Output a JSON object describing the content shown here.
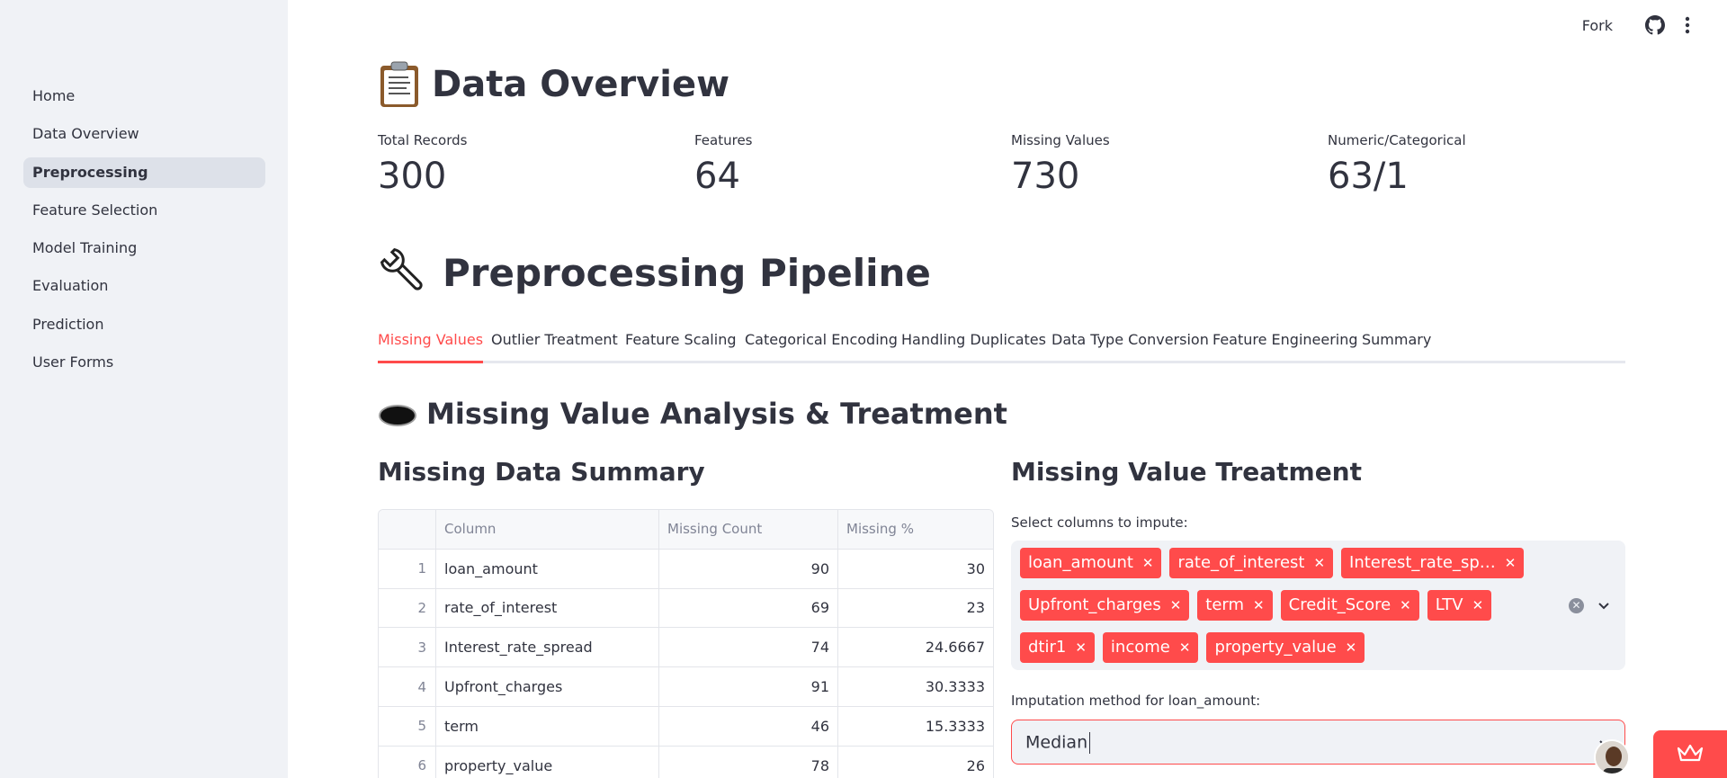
{
  "sidebar": {
    "items": [
      {
        "label": "Home"
      },
      {
        "label": "Data Overview"
      },
      {
        "label": "Preprocessing",
        "active": true
      },
      {
        "label": "Feature Selection"
      },
      {
        "label": "Model Training"
      },
      {
        "label": "Evaluation"
      },
      {
        "label": "Prediction"
      },
      {
        "label": "User Forms"
      }
    ]
  },
  "header": {
    "fork_label": "Fork",
    "github_icon": "github-icon",
    "menu_icon": "kebab-menu-icon"
  },
  "main": {
    "title": "Data Overview",
    "title_icon": "clipboard-icon",
    "metrics": [
      {
        "label": "Total Records",
        "value": "300"
      },
      {
        "label": "Features",
        "value": "64"
      },
      {
        "label": "Missing Values",
        "value": "730"
      },
      {
        "label": "Numeric/Categorical",
        "value": "63/1"
      }
    ],
    "pipeline_title": "Preprocessing Pipeline",
    "pipeline_icon": "wrench-icon",
    "tabs": [
      {
        "label": "Missing Values",
        "active": true
      },
      {
        "label": "Outlier Treatment"
      },
      {
        "label": "Feature Scaling"
      },
      {
        "label": "Categorical Encoding"
      },
      {
        "label": "Handling Duplicates"
      },
      {
        "label": "Data Type Conversion"
      },
      {
        "label": "Feature Engineering"
      },
      {
        "label": "Summary"
      }
    ],
    "section_title": "Missing Value Analysis & Treatment",
    "section_icon": "hole-icon",
    "summary": {
      "title": "Missing Data Summary",
      "columns": [
        "",
        "Column",
        "Missing Count",
        "Missing %"
      ],
      "rows": [
        {
          "idx": "1",
          "column": "loan_amount",
          "count": "90",
          "pct": "30"
        },
        {
          "idx": "2",
          "column": "rate_of_interest",
          "count": "69",
          "pct": "23"
        },
        {
          "idx": "3",
          "column": "Interest_rate_spread",
          "count": "74",
          "pct": "24.6667"
        },
        {
          "idx": "4",
          "column": "Upfront_charges",
          "count": "91",
          "pct": "30.3333"
        },
        {
          "idx": "5",
          "column": "term",
          "count": "46",
          "pct": "15.3333"
        },
        {
          "idx": "6",
          "column": "property_value",
          "count": "78",
          "pct": "26"
        }
      ]
    },
    "treatment": {
      "title": "Missing Value Treatment",
      "select_label": "Select columns to impute:",
      "chips": [
        [
          "loan_amount",
          "rate_of_interest",
          "Interest_rate_sp…"
        ],
        [
          "Upfront_charges",
          "term",
          "Credit_Score",
          "LTV"
        ],
        [
          "dtir1",
          "income",
          "property_value"
        ]
      ],
      "method_label": "Imputation method for loan_amount:",
      "method_value": "Median"
    }
  },
  "colors": {
    "accent": "#ff4b4b",
    "sidebar_bg": "#f0f2f6",
    "text": "#31333f"
  }
}
